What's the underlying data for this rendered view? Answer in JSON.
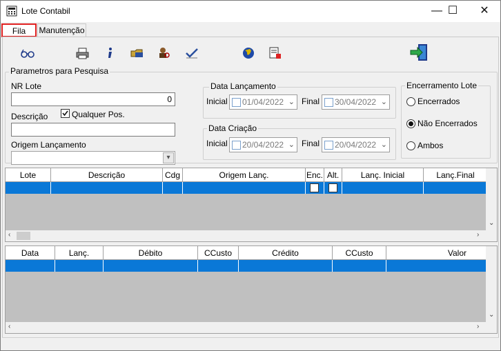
{
  "window": {
    "title": "Lote Contabil",
    "minimize": "—",
    "maximize": "☐",
    "close": "✕"
  },
  "tabs": [
    {
      "label": "Fila"
    },
    {
      "label": "Manutenção"
    }
  ],
  "toolbar": {
    "icons": [
      "glasses-icon",
      "printer-icon",
      "info-icon",
      "folder-icon",
      "user-search-icon",
      "check-icon",
      "globe-icon",
      "report-icon",
      "exit-door-icon"
    ]
  },
  "search": {
    "legend": "Parametros para Pesquisa",
    "nr_lote_label": "NR Lote",
    "nr_lote_value": "0",
    "descricao_label": "Descrição",
    "qualquer_pos_label": "Qualquer Pos.",
    "origem_label": "Origem Lançamento",
    "data_lancamento": {
      "legend": "Data Lançamento",
      "inicial_label": "Inicial",
      "inicial_value": "01/04/2022",
      "final_label": "Final",
      "final_value": "30/04/2022"
    },
    "data_criacao": {
      "legend": "Data Criação",
      "inicial_label": "Inicial",
      "inicial_value": "20/04/2022",
      "final_label": "Final",
      "final_value": "20/04/2022"
    },
    "encerramento": {
      "legend": "Encerramento Lote",
      "options": [
        "Encerrados",
        "Não Encerrados",
        "Ambos"
      ],
      "selected": "Não Encerrados"
    }
  },
  "grid_lotes": {
    "columns": [
      "Lote",
      "Descrição",
      "Cdg",
      "Origem Lanç.",
      "Enc.",
      "Alt.",
      "Lanç. Inicial",
      "Lanç.Final"
    ]
  },
  "grid_lancamentos": {
    "columns": [
      "Data",
      "Lanç.",
      "Débito",
      "CCusto",
      "Crédito",
      "CCusto",
      "Valor"
    ]
  },
  "colors": {
    "selection": "#0a78d7",
    "active_tab_border": "#e02020",
    "grid_background": "#c0c0c0"
  }
}
